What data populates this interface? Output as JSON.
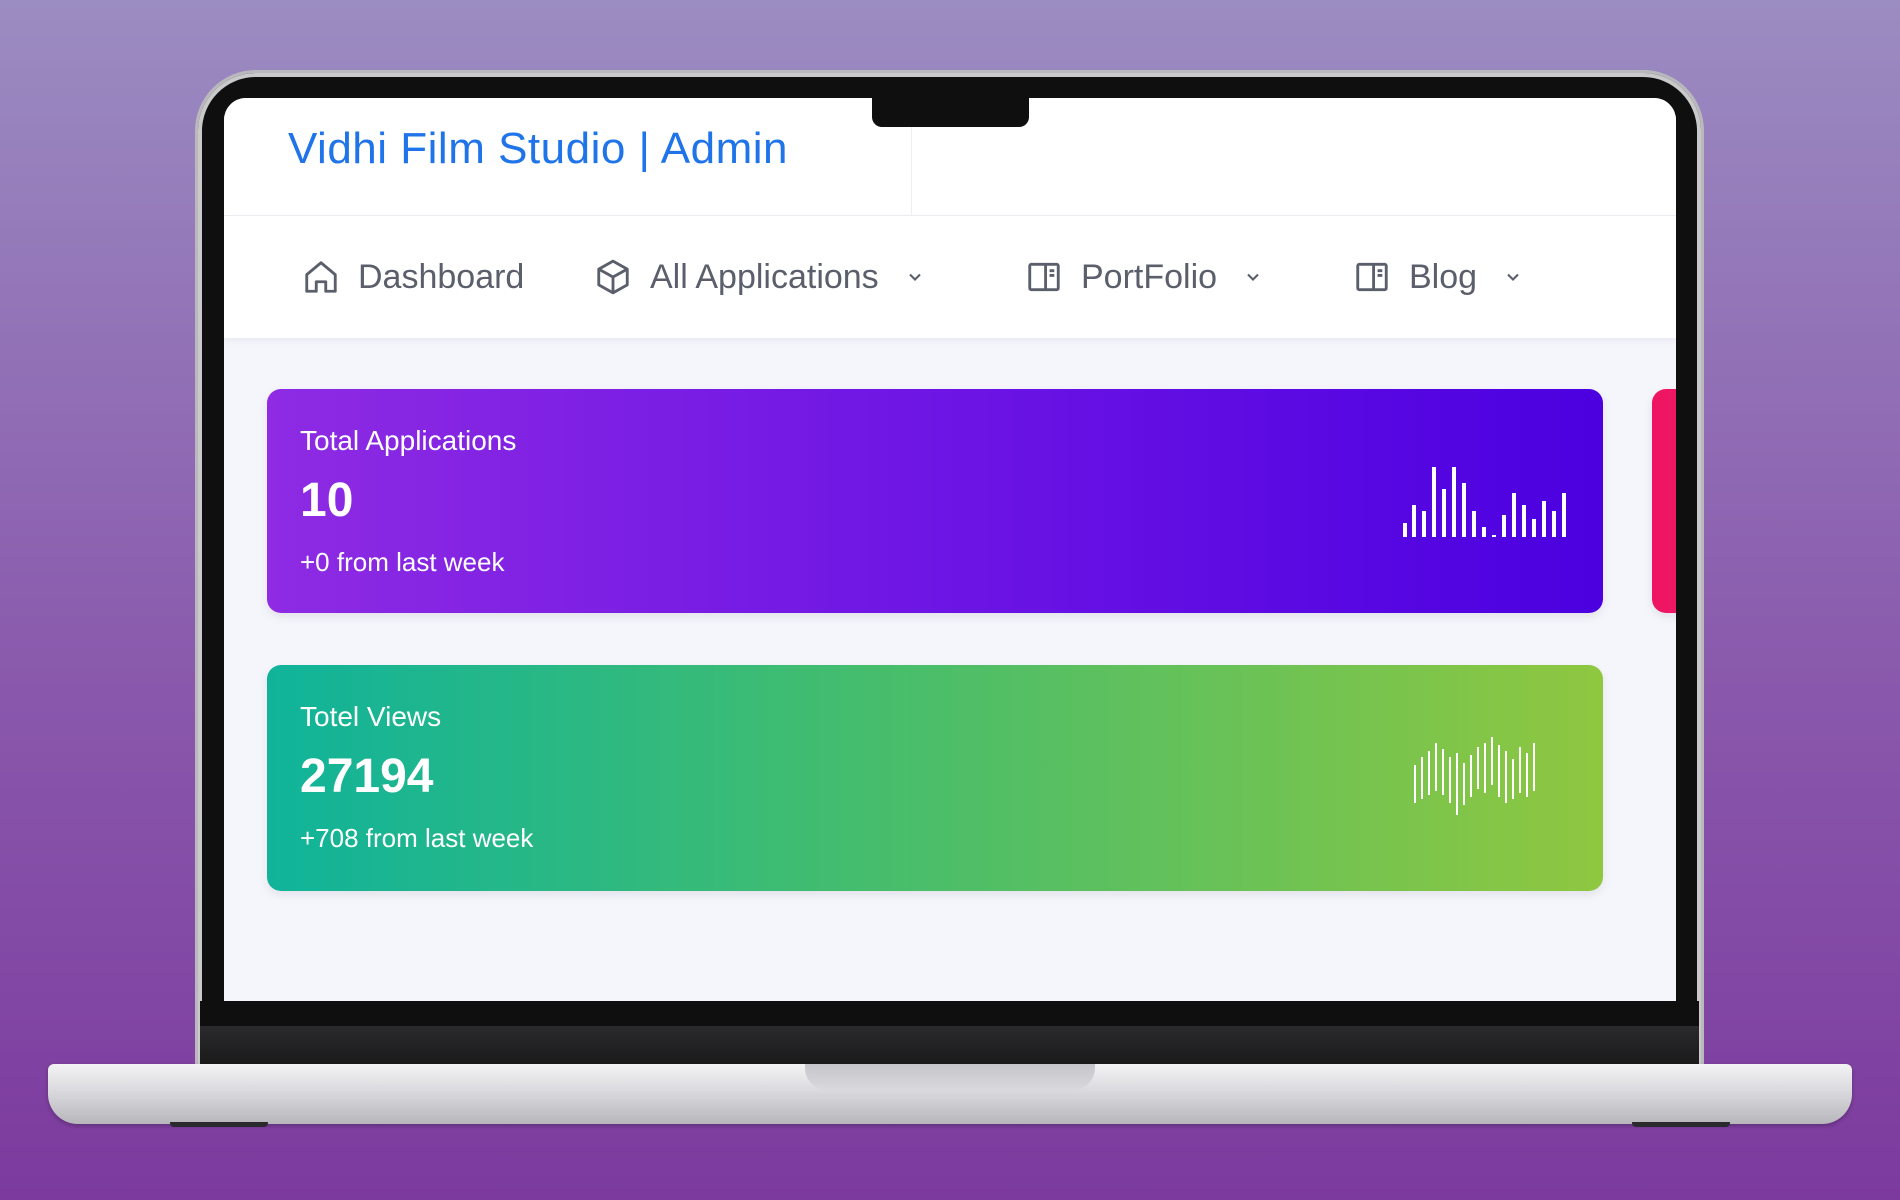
{
  "header": {
    "brand": "Vidhi Film Studio | Admin"
  },
  "nav": {
    "items": [
      {
        "label": "Dashboard",
        "icon": "home-icon",
        "has_dropdown": false
      },
      {
        "label": "All Applications",
        "icon": "box-icon",
        "has_dropdown": true
      },
      {
        "label": "PortFolio",
        "icon": "layout-icon",
        "has_dropdown": true
      },
      {
        "label": "Blog",
        "icon": "layout-icon",
        "has_dropdown": true
      }
    ]
  },
  "cards": [
    {
      "title": "Total Applications",
      "value": "10",
      "delta": "+0 from last week",
      "chart_icon": "bar-sparkline-icon"
    },
    {
      "title": "Totel Views",
      "value": "27194",
      "delta": "+708 from last week",
      "chart_icon": "wave-sparkline-icon"
    }
  ],
  "colors": {
    "brand": "#1e74e8",
    "card_purple_start": "#8e2be3",
    "card_purple_end": "#4b00e0",
    "card_green_start": "#10b39a",
    "card_green_end": "#8fc740",
    "card_pink": "#ef1463"
  }
}
